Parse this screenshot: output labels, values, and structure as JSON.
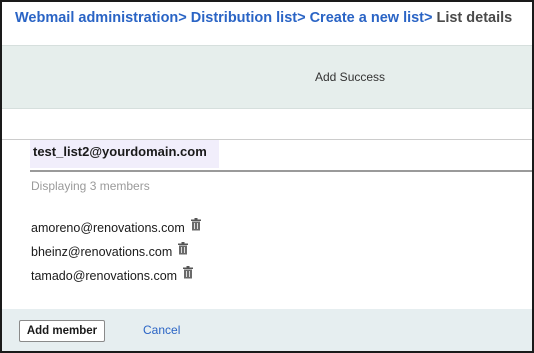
{
  "breadcrumb": {
    "items": [
      "Webmail administration",
      "Distribution list",
      "Create a new list"
    ],
    "separator": ">",
    "current": "List details"
  },
  "notification": {
    "text": "Add Success"
  },
  "list": {
    "name": "test_list2@yourdomain.com",
    "member_count_text": "Displaying 3 members",
    "members": [
      {
        "email": "amoreno@renovations.com"
      },
      {
        "email": "bheinz@renovations.com"
      },
      {
        "email": "tamado@renovations.com"
      }
    ]
  },
  "actions": {
    "add_member_label": "Add member",
    "cancel_label": "Cancel"
  },
  "icons": {
    "delete": "trash-icon"
  },
  "colors": {
    "link": "#2a64c5",
    "notification_bg": "#e6eeec",
    "footer_bg": "#e6eef0",
    "list_name_bg": "#f1eefb"
  }
}
